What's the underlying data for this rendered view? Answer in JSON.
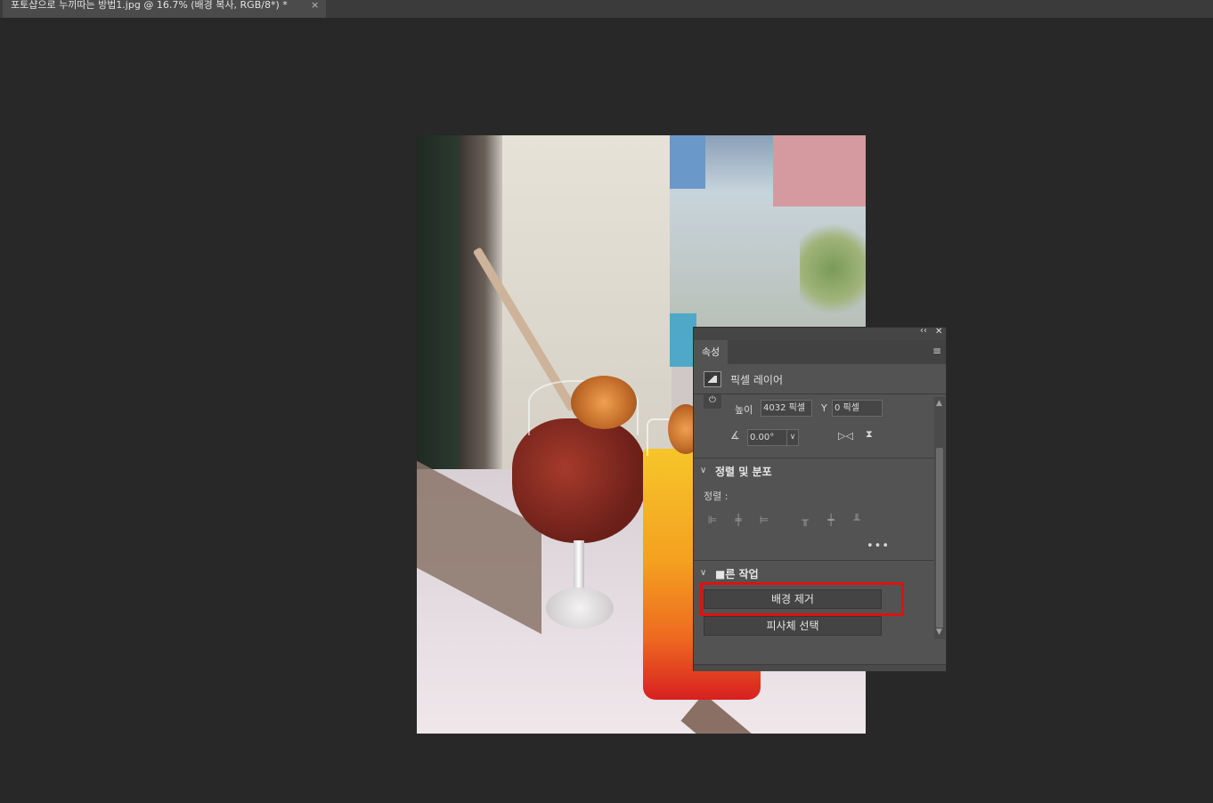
{
  "document": {
    "tab_title": "포토샵으로 누끼따는 방법1.jpg @ 16.7% (배경 복사, RGB/8*) *",
    "close_glyph": "×"
  },
  "panel": {
    "collapse_glyph": "‹‹",
    "close_glyph": "✕",
    "tab_label": "속성",
    "menu_glyph": "≡",
    "layer_type": "픽셀 레이어",
    "transform": {
      "height_label": "높이",
      "height_value": "4032 픽셀",
      "y_label": "Y",
      "y_value": "0 픽셀",
      "angle_value": "0.00°"
    },
    "align_section": {
      "title": "정렬 및 분포",
      "align_label": "정렬 :"
    },
    "quick_actions": {
      "title": "■른 작업",
      "remove_background": "배경 제거",
      "select_subject": "피사체 선택"
    },
    "icons": {
      "power": "⏻",
      "chevron": "∨",
      "angle": "∡",
      "more": "•••",
      "flip_h": "▷◁",
      "flip_v": "⧗",
      "scroll_up": "▲",
      "scroll_down": "▼"
    }
  },
  "highlight_color": "#e01010"
}
